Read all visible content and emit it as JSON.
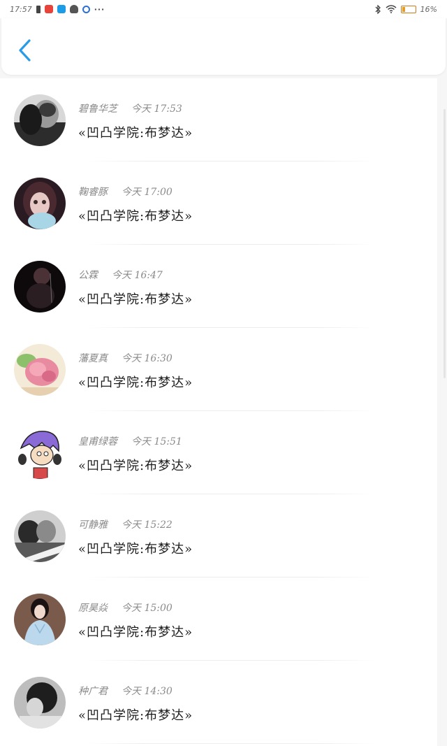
{
  "status_bar": {
    "time": "17:57",
    "more": "···",
    "battery_percent": "16%",
    "icons": [
      "battery-saver-icon",
      "app-red-icon",
      "app-search-icon",
      "notification-icon",
      "app-circle-icon",
      "bluetooth-icon",
      "wifi-icon",
      "battery-icon"
    ]
  },
  "nav": {
    "back_icon": "chevron-left-icon",
    "accent": "#2a9be6"
  },
  "messages": [
    {
      "name": "碧鲁华芝",
      "time": "今天 17:53",
      "text": "«凹凸学院:布梦达»",
      "avatar": "couple-bw-photo"
    },
    {
      "name": "鞠睿豚",
      "time": "今天 17:00",
      "text": "«凹凸学院:布梦达»",
      "avatar": "girl-plush-photo"
    },
    {
      "name": "公霖",
      "time": "今天 16:47",
      "text": "«凹凸学院:布梦达»",
      "avatar": "dark-portrait-photo"
    },
    {
      "name": "藩夏真",
      "time": "今天 16:30",
      "text": "«凹凸学院:布梦达»",
      "avatar": "pink-flowers-photo"
    },
    {
      "name": "皇甫绿蓉",
      "time": "今天 15:51",
      "text": "«凹凸学院:布梦达»",
      "avatar": "anime-purple-hair"
    },
    {
      "name": "可静雅",
      "time": "今天 15:22",
      "text": "«凹凸学院:布梦达»",
      "avatar": "couple-bw-caption"
    },
    {
      "name": "原昊焱",
      "time": "今天 15:00",
      "text": "«凹凸学院:布梦达»",
      "avatar": "girl-blue-hanfu"
    },
    {
      "name": "种广君",
      "time": "今天 14:30",
      "text": "«凹凸学院:布梦达»",
      "avatar": "girl-bw-hair"
    }
  ]
}
